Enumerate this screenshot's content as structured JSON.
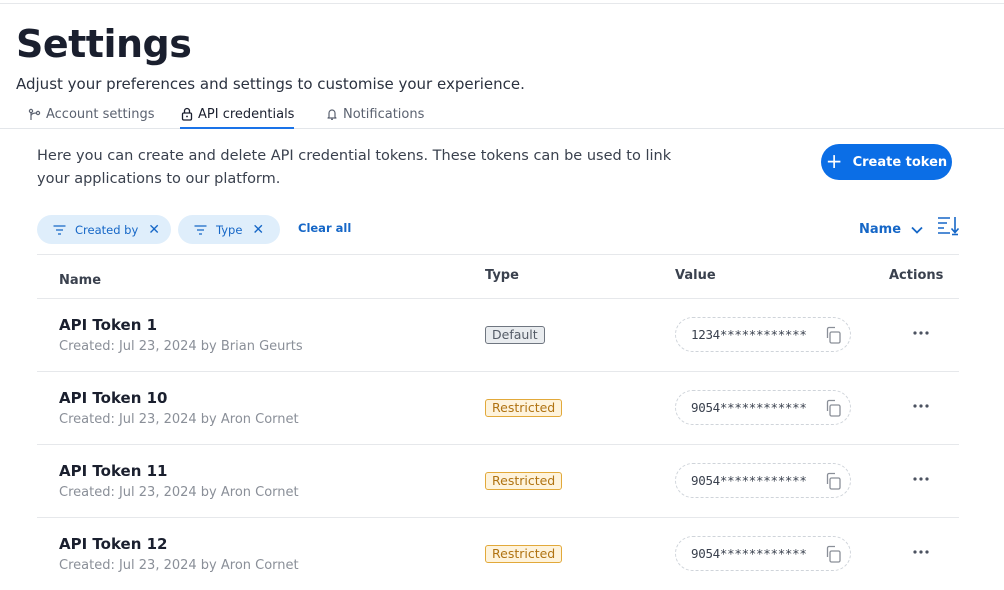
{
  "header": {
    "title": "Settings",
    "subtitle": "Adjust your preferences and settings to customise your experience."
  },
  "tabs": [
    {
      "label": "Account settings",
      "icon": "branch-icon",
      "active": false
    },
    {
      "label": "API credentials",
      "icon": "lock-icon",
      "active": true
    },
    {
      "label": "Notifications",
      "icon": "bell-icon",
      "active": false
    }
  ],
  "intro": "Here you can create and delete API credential tokens. These tokens can be used to link your applications to our platform.",
  "create_button": {
    "label": "Create token",
    "icon": "plus-icon"
  },
  "filters": {
    "chips": [
      {
        "label": "Created by"
      },
      {
        "label": "Type"
      }
    ],
    "clear_label": "Clear all"
  },
  "sort": {
    "label": "Name"
  },
  "table": {
    "columns": {
      "name": "Name",
      "type": "Type",
      "value": "Value",
      "actions": "Actions"
    },
    "rows": [
      {
        "name": "API Token 1",
        "meta": "Created: Jul 23, 2024 by Brian Geurts",
        "type": "Default",
        "value": "1234************"
      },
      {
        "name": "API Token 10",
        "meta": "Created: Jul 23, 2024 by Aron Cornet",
        "type": "Restricted",
        "value": "9054************"
      },
      {
        "name": "API Token 11",
        "meta": "Created: Jul 23, 2024 by Aron Cornet",
        "type": "Restricted",
        "value": "9054************"
      },
      {
        "name": "API Token 12",
        "meta": "Created: Jul 23, 2024 by Aron Cornet",
        "type": "Restricted",
        "value": "9054************"
      }
    ]
  },
  "colors": {
    "accent": "#0b6ee6",
    "link": "#1667c7",
    "chip_bg": "#dfeefb",
    "restricted_bg": "#fef3dc",
    "restricted_border": "#e2a93a",
    "default_bg": "#e9ecef"
  }
}
